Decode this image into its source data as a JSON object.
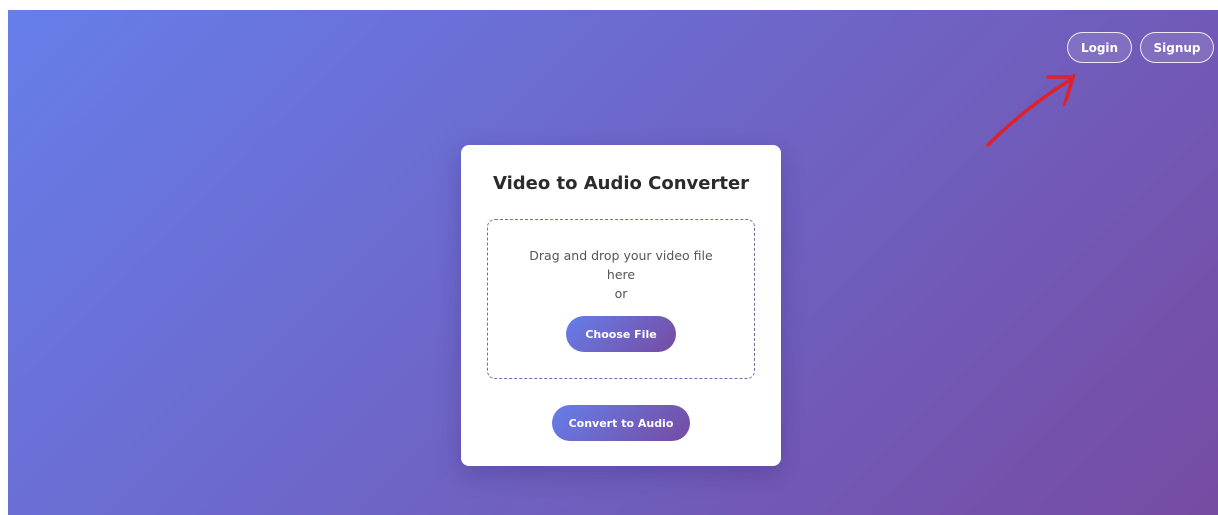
{
  "nav": {
    "login_label": "Login",
    "signup_label": "Signup"
  },
  "card": {
    "title": "Video to Audio Converter",
    "drop_zone": {
      "line1": "Drag and drop your video file",
      "line2": "here",
      "line3": "or",
      "choose_label": "Choose File"
    },
    "convert_label": "Convert to Audio"
  },
  "colors": {
    "gradient_start": "#667eea",
    "gradient_end": "#764ba2",
    "annotation_arrow": "#e0202a"
  },
  "icons": {
    "annotation": "red-arrow-icon"
  }
}
